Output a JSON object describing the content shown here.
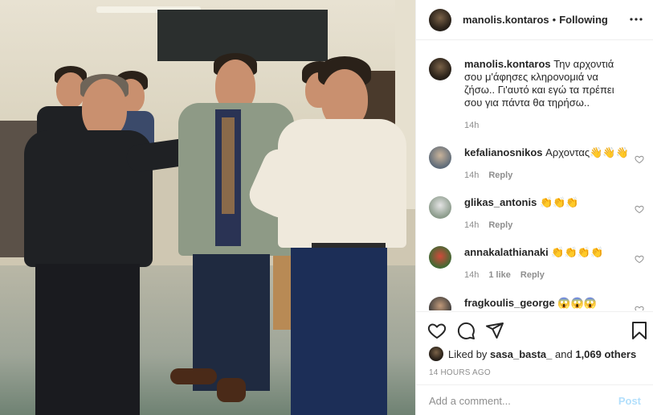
{
  "header": {
    "username": "manolis.kontaros",
    "separator": "•",
    "follow_label": "Following"
  },
  "caption": {
    "username": "manolis.kontaros",
    "text": "Την αρχοντιά σου μ'άφησες κληρονομιά να ζήσω.. Γι'αυτό και εγώ τα πρέπει σου για πάντα θα τηρήσω..",
    "time": "14h"
  },
  "comments": [
    {
      "username": "kefalianosnikos",
      "text": "Αρχοντας👋👋👋",
      "time": "14h",
      "likes": "",
      "reply": "Reply"
    },
    {
      "username": "glikas_antonis",
      "text": "👏👏👏",
      "time": "14h",
      "likes": "",
      "reply": "Reply"
    },
    {
      "username": "annakalathianaki",
      "text": "👏👏👏👏",
      "time": "14h",
      "likes": "1 like",
      "reply": "Reply"
    },
    {
      "username": "fragkoulis_george",
      "text": "😱😱😱",
      "time": "",
      "likes": "",
      "reply": ""
    }
  ],
  "likes": {
    "prefix": "Liked by",
    "user": "sasa_basta_",
    "joiner": "and",
    "others": "1,069 others"
  },
  "timestamp": "14 HOURS AGO",
  "add_comment": {
    "placeholder": "Add a comment...",
    "post_label": "Post"
  },
  "icons": {
    "more": "more-horizontal-icon",
    "like": "heart-icon",
    "comment": "comment-icon",
    "share": "share-icon",
    "save": "bookmark-icon"
  },
  "colors": {
    "text": "#262626",
    "muted": "#8e8e8e",
    "border": "#efefef",
    "post_button": "#b2dffc"
  }
}
